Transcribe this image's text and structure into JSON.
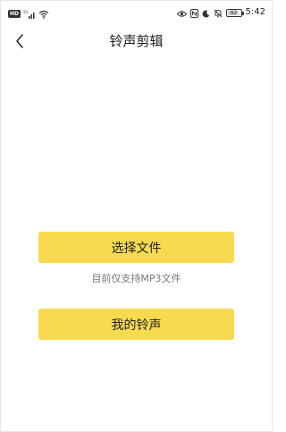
{
  "status_bar": {
    "network_badge": "HD",
    "battery_percent": "92",
    "battery_level": 0.92,
    "time": "5:42",
    "icons": [
      "signal-icon",
      "wifi-icon",
      "eye-icon",
      "nfc-icon",
      "moon-icon",
      "mute-icon",
      "battery-icon"
    ]
  },
  "nav": {
    "back_icon": "chevron-left-icon",
    "title": "铃声剪辑"
  },
  "main": {
    "select_file_label": "选择文件",
    "hint": "目前仅支持MP3文件",
    "my_ringtones_label": "我的铃声"
  },
  "colors": {
    "accent": "#f7da4f",
    "hint_text": "#777777",
    "title_text": "#1a1a1a"
  }
}
